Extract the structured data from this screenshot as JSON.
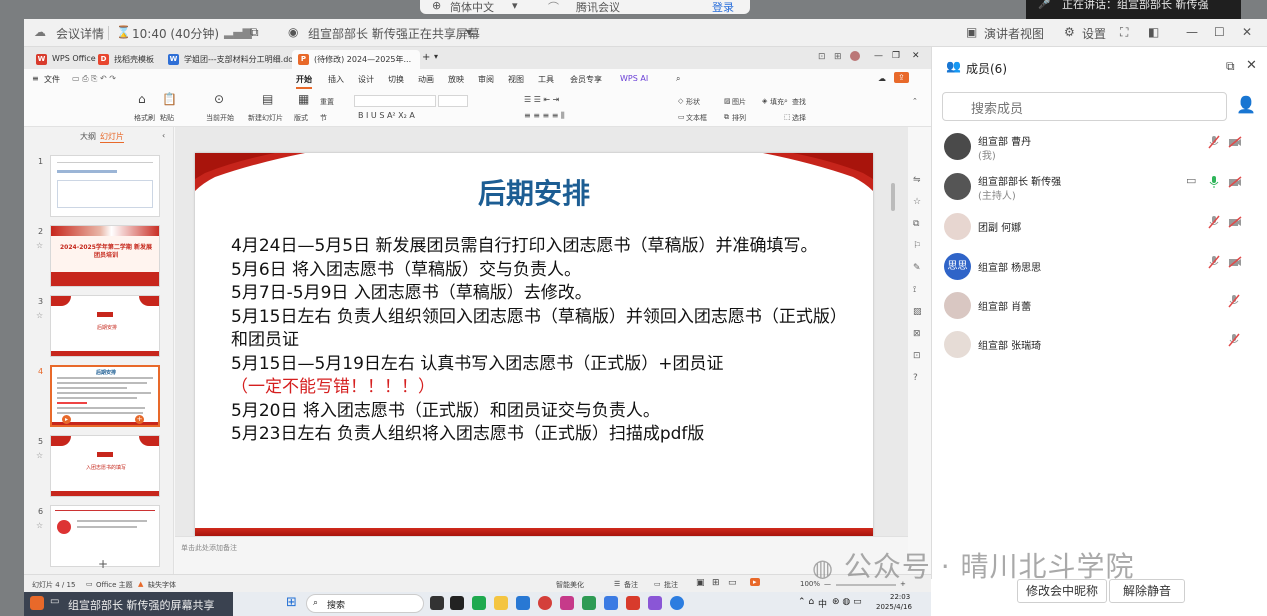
{
  "overlay": {
    "lang": "简体中文",
    "meeting_app": "腾讯会议",
    "login": "登录",
    "speaking": "正在讲话：组宣部部长 靳传强"
  },
  "meetbar": {
    "details": "会议详情",
    "time": "10:40 (40分钟)",
    "sharing": "组宣部部长 靳传强正在共享屏幕",
    "view": "演讲者视图",
    "settings": "设置"
  },
  "wps": {
    "tabs": [
      "WPS Office",
      "找稻壳模板",
      "学姐团---支部材料分工明细.docx",
      "(待修改) 2024—2025年..."
    ],
    "ribbon_tabs": [
      "开始",
      "插入",
      "设计",
      "切换",
      "动画",
      "放映",
      "审阅",
      "视图",
      "工具",
      "会员专享",
      "WPS AI"
    ],
    "file_menu": "文件",
    "ribbon": {
      "format_painter": "格式刷",
      "paste": "粘贴",
      "from_current": "当前开始",
      "new_slide": "新建幻灯片",
      "layout": "版式",
      "section": "节",
      "reset": "重置",
      "shape": "形状",
      "picture": "图片",
      "fill": "填充",
      "textbox": "文本框",
      "arrange": "排列",
      "find": "查找",
      "select": "选择"
    },
    "pane_tabs": [
      "大纲",
      "幻灯片"
    ],
    "add_slide": "+",
    "notes_placeholder": "单击此处添加备注",
    "status": {
      "slide_pos": "幻灯片 4 / 15",
      "theme": "Office 主题",
      "missing_font": "缺失字体",
      "smart_beauty": "智能美化",
      "notes": "备注",
      "comment": "批注",
      "zoom": "100%"
    }
  },
  "slide": {
    "title": "后期安排",
    "lines": [
      {
        "text": "4月24日—5月5日   新发展团员需自行打印入团志愿书（草稿版）并准确填写。",
        "red": false
      },
      {
        "text": "5月6日  将入团志愿书（草稿版）交与负责人。",
        "red": false
      },
      {
        "text": "5月7日-5月9日  入团志愿书（草稿版）去修改。",
        "red": false
      },
      {
        "text": "5月15日左右    负责人组织领回入团志愿书（草稿版）并领回入团志愿书（正式版）和团员证",
        "red": false
      },
      {
        "text": "5月15日—5月19日左右 认真书写入团志愿书（正式版）+团员证",
        "red": false
      },
      {
        "text": "（一定不能写错！！！！）",
        "red": true
      },
      {
        "text": "5月20日    将入团志愿书（正式版）和团员证交与负责人。",
        "red": false
      },
      {
        "text": "5月23日左右    负责人组织将入团志愿书（正式版）扫描成pdf版",
        "red": false
      }
    ]
  },
  "thumbnails": [
    {
      "num": "1",
      "caption": ""
    },
    {
      "num": "2",
      "caption": "2024-2025学年第二学期 新发展团员培训"
    },
    {
      "num": "3",
      "caption": "后期安排"
    },
    {
      "num": "4",
      "caption": "后期安排"
    },
    {
      "num": "5",
      "caption": "入团志愿书的填写"
    },
    {
      "num": "6",
      "caption": ""
    }
  ],
  "members": {
    "title": "成员(6)",
    "search_placeholder": "搜索成员",
    "list": [
      {
        "name": "组宣部 曹丹",
        "role": "(我)",
        "avatar_color": "#4a4a4a",
        "avatar_text": ""
      },
      {
        "name": "组宣部部长 靳传强",
        "role": "(主持人)",
        "avatar_color": "#555555",
        "avatar_text": ""
      },
      {
        "name": "团副 何娜",
        "role": "",
        "avatar_color": "#e7d6d0",
        "avatar_text": ""
      },
      {
        "name": "组宣部 杨思思",
        "role": "",
        "avatar_color": "#2f64c8",
        "avatar_text": "思思"
      },
      {
        "name": "组宣部 肖蕾",
        "role": "",
        "avatar_color": "#d9c7c2",
        "avatar_text": ""
      },
      {
        "name": "组宣部 张瑞琦",
        "role": "",
        "avatar_color": "#e6dcd6",
        "avatar_text": ""
      }
    ],
    "rename_button": "修改会中昵称",
    "unmute_button": "解除静音"
  },
  "watermark": "公众号 · 晴川北斗学院",
  "taskbar": {
    "share_label": "组宣部部长 靳传强的屏幕共享",
    "search": "搜索",
    "time": "22:03",
    "date": "2025/4/16",
    "ime": "中"
  },
  "colors": {
    "title_blue": "#1c5d93",
    "warn_red": "#d51f1f",
    "wps_orange": "#e8692a",
    "curtain_red": "#c6241b"
  }
}
